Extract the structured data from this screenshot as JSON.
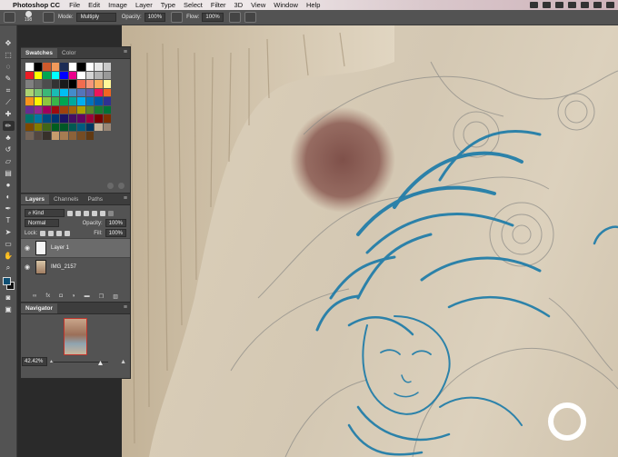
{
  "menubar": {
    "app_name": "Photoshop CC",
    "items": [
      "File",
      "Edit",
      "Image",
      "Layer",
      "Type",
      "Select",
      "Filter",
      "3D",
      "View",
      "Window",
      "Help"
    ]
  },
  "options": {
    "brush_size": "198",
    "mode_label": "Mode:",
    "mode_value": "Multiply",
    "opacity_label": "Opacity:",
    "opacity_value": "100%",
    "flow_label": "Flow:",
    "flow_value": "100%"
  },
  "swatches": {
    "tabs": [
      "Swatches",
      "Color"
    ],
    "colors": [
      "#ffffff",
      "#000000",
      "#d05a2c",
      "#f29a5b",
      "#1c2c55",
      "#ffffff",
      "#000000",
      "#ffffff",
      "#e7e7e7",
      "#c9c9c9",
      "#ed1c24",
      "#ffff00",
      "#00a651",
      "#00ffff",
      "#0000ff",
      "#ec008c",
      "#ffffff",
      "#d4d4d4",
      "#b3b3b3",
      "#999999",
      "#808080",
      "#666666",
      "#4d4d4d",
      "#333333",
      "#1a1a1a",
      "#000000",
      "#f26c4f",
      "#f69679",
      "#fbaf5d",
      "#fff799",
      "#acd373",
      "#7cc576",
      "#3bb878",
      "#1abbb4",
      "#00bff3",
      "#448ccb",
      "#5574b9",
      "#605ca8",
      "#ed145b",
      "#f26522",
      "#f7941d",
      "#fff200",
      "#8dc63f",
      "#39b54a",
      "#00a651",
      "#00a99d",
      "#00aeef",
      "#0072bc",
      "#0054a6",
      "#2e3192",
      "#662d91",
      "#92278f",
      "#9e005d",
      "#9e0b0f",
      "#a0410d",
      "#a36209",
      "#aba000",
      "#598527",
      "#197b30",
      "#007236",
      "#00746b",
      "#0076a3",
      "#004a80",
      "#003471",
      "#1b1464",
      "#440e62",
      "#630460",
      "#9e0039",
      "#790000",
      "#7b2e00",
      "#7d4900",
      "#827b00",
      "#406618",
      "#005e20",
      "#005826",
      "#005952",
      "#005b7f",
      "#003663",
      "#c7b299",
      "#998675",
      "#736357",
      "#534741",
      "#37302a",
      "#c69c6d",
      "#a67c52",
      "#8c6239",
      "#754c24",
      "#603913"
    ]
  },
  "layers": {
    "tabs": [
      "Layers",
      "Channels",
      "Paths"
    ],
    "filter_kind": "Kind",
    "blend_mode": "Normal",
    "opacity_label": "Opacity:",
    "opacity_value": "100%",
    "lock_label": "Lock:",
    "fill_label": "Fill:",
    "fill_value": "100%",
    "items": [
      {
        "name": "Layer 1",
        "selected": true
      },
      {
        "name": "IMG_2157",
        "selected": false
      }
    ],
    "footer_icons": [
      "link-icon",
      "fx-icon",
      "mask-icon",
      "adjustment-icon",
      "folder-icon",
      "new-layer-icon",
      "trash-icon"
    ]
  },
  "navigator": {
    "tab": "Navigator",
    "zoom": "42.42%",
    "zoom_fraction": 0.85
  },
  "toolbar": {
    "tools": [
      "move-tool-icon",
      "marquee-tool-icon",
      "lasso-tool-icon",
      "quick-select-icon",
      "crop-tool-icon",
      "eyedropper-icon",
      "healing-brush-icon",
      "brush-tool-icon",
      "clone-stamp-icon",
      "history-brush-icon",
      "eraser-icon",
      "gradient-icon",
      "blur-icon",
      "dodge-icon",
      "pen-tool-icon",
      "type-tool-icon",
      "path-select-icon",
      "shape-tool-icon",
      "hand-tool-icon",
      "zoom-tool-icon"
    ],
    "foreground_color": "#0e4f73",
    "background_color": "#111111"
  }
}
